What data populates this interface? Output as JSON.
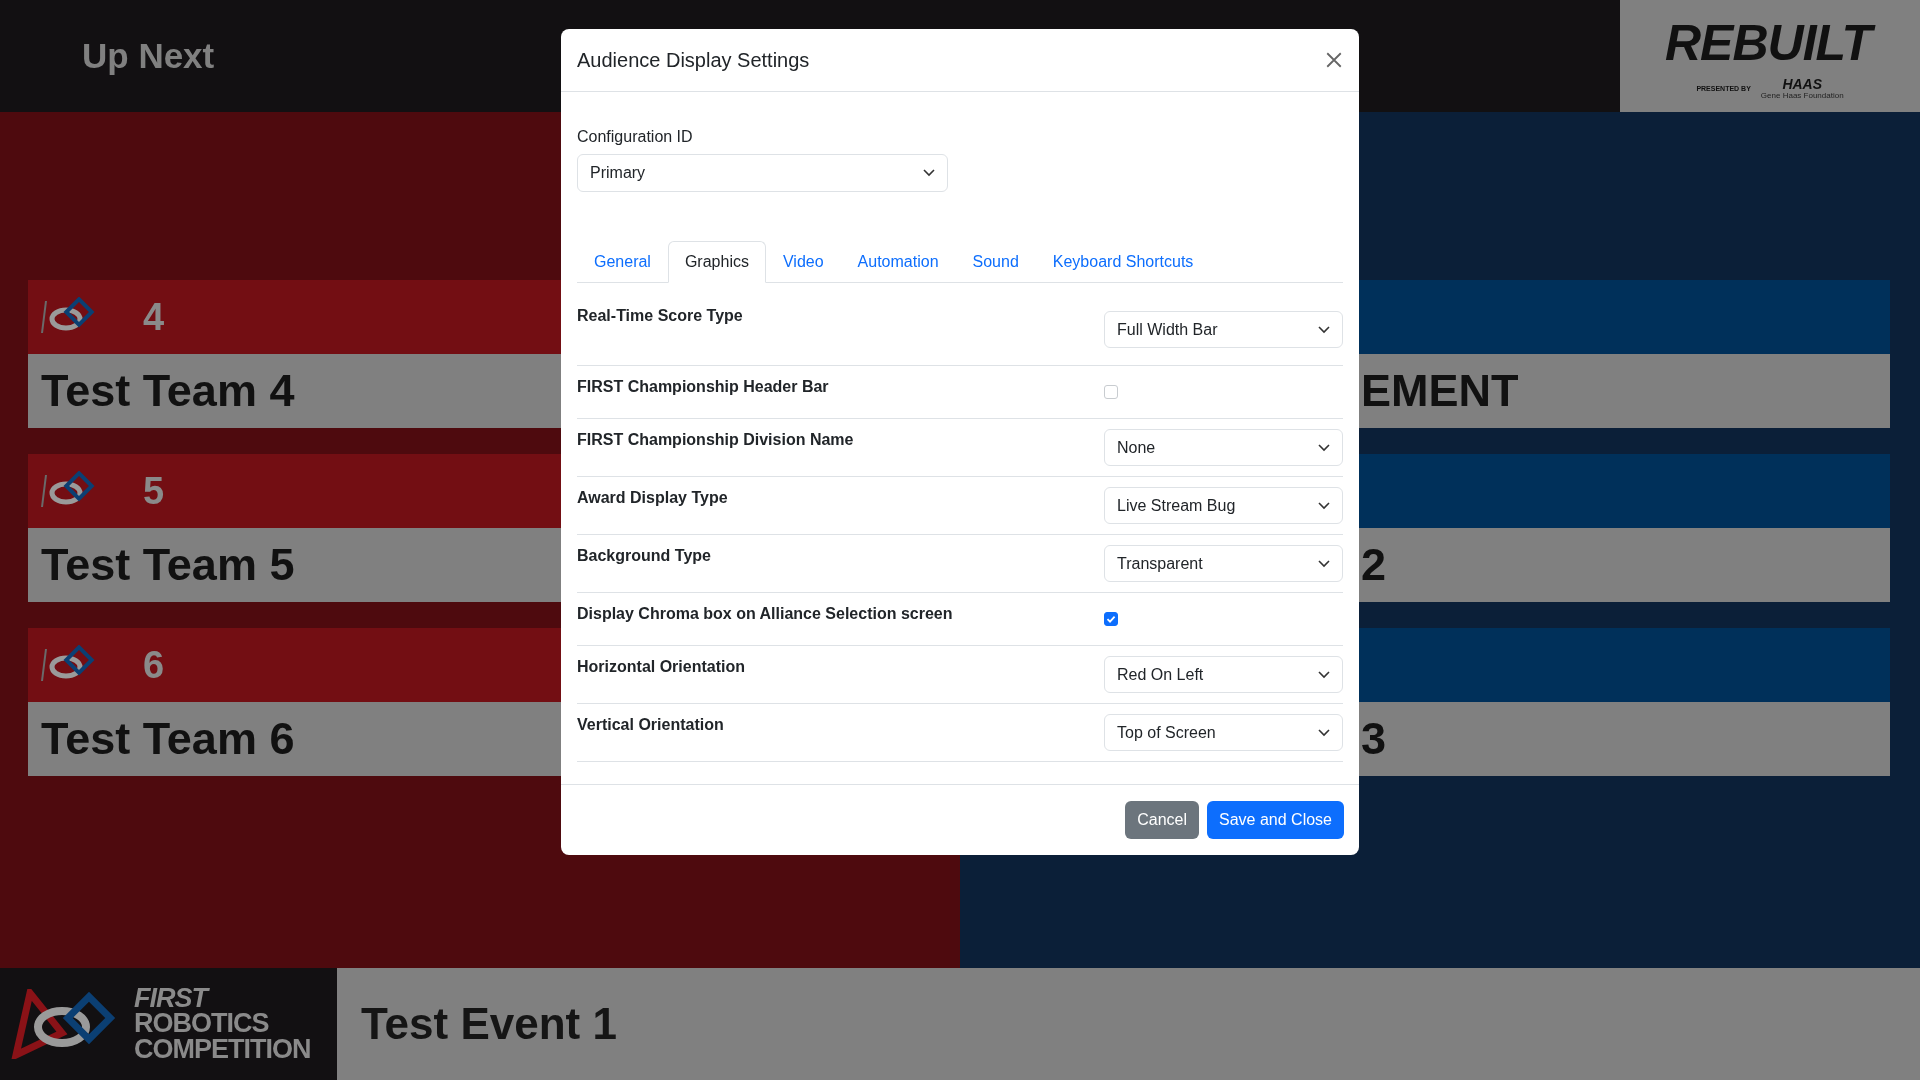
{
  "top_bar": {
    "title": "Up Next",
    "logo": {
      "wordmark": "REBUILT",
      "presented_by": "PRESENTED BY",
      "sponsor": "HAAS",
      "sponsor_sub": "Gene Haas Foundation"
    }
  },
  "red_teams": [
    {
      "number": "4",
      "name": "Test Team 4"
    },
    {
      "number": "5",
      "name": "Test Team 5"
    },
    {
      "number": "6",
      "name": "Test Team 6"
    }
  ],
  "blue_teams": [
    {
      "name": "EMENT"
    },
    {
      "name": "2"
    },
    {
      "name": "3"
    }
  ],
  "bottom_bar": {
    "logo_lines": [
      "FIRST",
      "ROBOTICS",
      "COMPETITION"
    ],
    "event_name": "Test Event 1"
  },
  "dialog": {
    "title": "Audience Display Settings",
    "config_label": "Configuration ID",
    "config_value": "Primary",
    "tabs": [
      {
        "label": "General",
        "selected": false
      },
      {
        "label": "Graphics",
        "selected": true
      },
      {
        "label": "Video",
        "selected": false
      },
      {
        "label": "Automation",
        "selected": false
      },
      {
        "label": "Sound",
        "selected": false
      },
      {
        "label": "Keyboard Shortcuts",
        "selected": false
      }
    ],
    "settings": [
      {
        "kind": "select",
        "label": "Real-Time Score Type",
        "value": "Full Width Bar"
      },
      {
        "kind": "checkbox",
        "label": "FIRST Championship Header Bar",
        "checked": false
      },
      {
        "kind": "select",
        "label": "FIRST Championship Division Name",
        "value": "None"
      },
      {
        "kind": "select",
        "label": "Award Display Type",
        "value": "Live Stream Bug"
      },
      {
        "kind": "select",
        "label": "Background Type",
        "value": "Transparent"
      },
      {
        "kind": "checkbox",
        "label": "Display Chroma box on Alliance Selection screen",
        "checked": true
      },
      {
        "kind": "select",
        "label": "Horizontal Orientation",
        "value": "Red On Left"
      },
      {
        "kind": "select",
        "label": "Vertical Orientation",
        "value": "Top of Screen"
      }
    ],
    "buttons": [
      {
        "kind": "secondary",
        "label": "Cancel"
      },
      {
        "kind": "primary",
        "label": "Save and Close"
      }
    ]
  }
}
